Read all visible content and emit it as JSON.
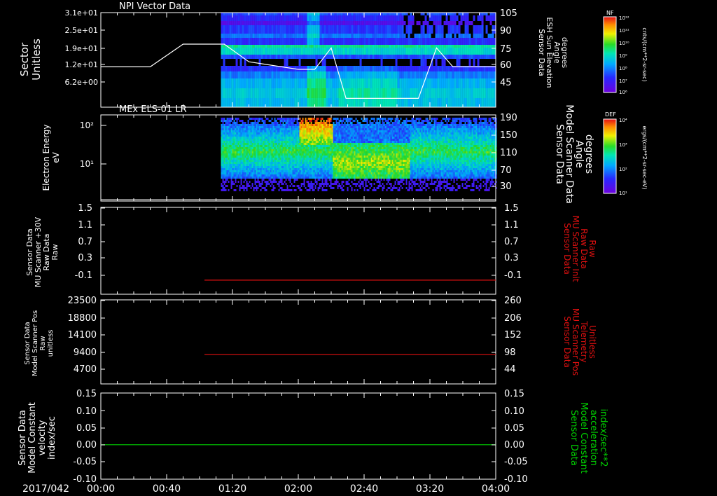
{
  "date_label": "2017/042",
  "time_ticks": [
    "00:00",
    "00:40",
    "01:20",
    "02:00",
    "02:40",
    "03:20",
    "04:00"
  ],
  "colors": {
    "background": "#000000",
    "axes": "#ffffff",
    "red_trace": "#e01010",
    "green_trace": "#00d000",
    "missing": "#000000"
  },
  "panels": [
    {
      "title": "NPI Vector Data",
      "left_label": [
        "Sector",
        "Unitless"
      ],
      "left_ticks": [
        "3.1e+01",
        "2.5e+01",
        "1.9e+01",
        "1.2e+01",
        "6.2e+00"
      ],
      "right_label": [
        "Sensor Data",
        "ESH Sun Elevation",
        "Angle",
        "degrees"
      ],
      "right_ticks": [
        "105",
        "90",
        "75",
        "60",
        "45"
      ],
      "colorbar": {
        "label": "NF",
        "units": "cnts/(cm**2-sr-sec)",
        "ticks": [
          "10¹²",
          "10¹¹",
          "10¹⁰",
          "10⁹",
          "10⁸",
          "10⁷",
          "10⁶"
        ]
      }
    },
    {
      "title": "MEx ELS-01 LR",
      "left_label": [
        "Electron Energy",
        "eV"
      ],
      "left_ticks": [
        "10²",
        "10¹"
      ],
      "right_label": [
        "Sensor Data",
        "Model Scanner Data",
        "Angle",
        "degrees"
      ],
      "right_ticks": [
        "190",
        "150",
        "110",
        "70",
        "30"
      ],
      "colorbar": {
        "label": "DEF",
        "units": "ergs/(cm**2-sr-sec-eV)",
        "ticks": [
          "10⁴",
          "10³",
          "10²",
          "10¹"
        ]
      }
    },
    {
      "title": "",
      "left_label": [
        "Sensor Data",
        "MU Scanner +30V",
        "Raw Data",
        "Raw"
      ],
      "left_ticks": [
        "1.5",
        "1.1",
        "0.7",
        "0.3",
        "-0.1"
      ],
      "right_label": [
        "Sensor Data",
        "MU Scanner Init",
        "Raw Data",
        "Raw"
      ],
      "right_ticks": [
        "1.5",
        "1.1",
        "0.7",
        "0.3",
        "-0.1"
      ]
    },
    {
      "title": "",
      "left_label": [
        "Sensor Data",
        "Model Scanner Pos",
        "Raw",
        "unitless"
      ],
      "left_ticks": [
        "23500",
        "18800",
        "14100",
        "9400",
        "4700"
      ],
      "right_label": [
        "Sensor Data",
        "MU Scanner Pos",
        "Telemetry",
        "Unitless"
      ],
      "right_ticks": [
        "260",
        "206",
        "152",
        "98",
        "44"
      ]
    },
    {
      "title": "",
      "left_label": [
        "Sensor Data",
        "Model Constant",
        "velocity",
        "index/sec"
      ],
      "left_ticks": [
        "0.15",
        "0.10",
        "0.05",
        "0.00",
        "-0.05",
        "-0.10"
      ],
      "right_label": [
        "Sensor Data",
        "Model Constant",
        "acceleration",
        "index/sec**2"
      ],
      "right_ticks": [
        "0.15",
        "0.10",
        "0.05",
        "0.00",
        "-0.05",
        "-0.10"
      ]
    }
  ],
  "chart_data": [
    {
      "type": "heatmap",
      "title": "NPI Vector Data",
      "ylabel": "Sector Unitless",
      "y_ticks": [
        "3.1e+01",
        "2.5e+01",
        "1.9e+01",
        "1.2e+01",
        "6.2e+00"
      ],
      "data_start": "01:13",
      "overlay": {
        "name": "ESH Sun Elevation Angle",
        "axis": "right",
        "ylim": [
          30,
          105
        ],
        "points": [
          [
            "00:00",
            62
          ],
          [
            "00:30",
            62
          ],
          [
            "00:50",
            80
          ],
          [
            "01:00",
            80
          ],
          [
            "01:15",
            80
          ],
          [
            "01:30",
            66
          ],
          [
            "02:00",
            60
          ],
          [
            "02:10",
            60
          ],
          [
            "02:20",
            77
          ],
          [
            "02:29",
            37
          ],
          [
            "02:50",
            37
          ],
          [
            "03:13",
            37
          ],
          [
            "03:24",
            77
          ],
          [
            "03:34",
            62
          ],
          [
            "04:00",
            62
          ]
        ]
      }
    },
    {
      "type": "heatmap",
      "title": "MEx ELS-01 LR",
      "ylabel": "Electron Energy eV",
      "y_scale": "log",
      "y_ticks": [
        "10²",
        "10¹"
      ],
      "data_start": "01:13",
      "overlay": {
        "name": "Model Scanner Data Angle",
        "axis": "right",
        "ylim": [
          10,
          190
        ],
        "points": [
          [
            "00:00",
            13
          ],
          [
            "04:00",
            13
          ]
        ]
      }
    },
    {
      "type": "line",
      "ylim": [
        -0.3,
        1.5
      ],
      "series": [
        {
          "name": "MU Scanner Init Raw Data",
          "axis": "right",
          "color": "#e01010",
          "points": [
            [
              "01:03",
              -0.05
            ],
            [
              "04:00",
              -0.05
            ]
          ]
        }
      ]
    },
    {
      "type": "line",
      "ylim": [
        0,
        23500
      ],
      "series": [
        {
          "name": "MU Scanner Pos Telemetry",
          "axis": "right",
          "color": "#e01010",
          "points": [
            [
              "01:03",
              92
            ],
            [
              "04:00",
              92
            ]
          ]
        }
      ]
    },
    {
      "type": "line",
      "ylim": [
        -0.1,
        0.15
      ],
      "series": [
        {
          "name": "Model Constant acceleration",
          "axis": "right",
          "color": "#00d000",
          "points": [
            [
              "00:00",
              0.0
            ],
            [
              "04:00",
              0.0
            ]
          ]
        }
      ]
    }
  ]
}
